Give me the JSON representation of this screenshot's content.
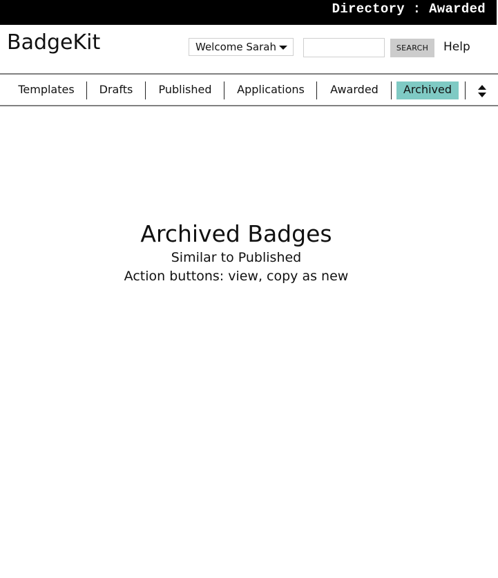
{
  "topbar": {
    "title": "Directory : Awarded"
  },
  "header": {
    "logo": "BadgeKit",
    "user_menu": {
      "selected": "Welcome Sarah",
      "icon": "caret-down-icon"
    },
    "search": {
      "value": "",
      "placeholder": "",
      "button_label": "SEARCH"
    },
    "help_label": "Help"
  },
  "nav": {
    "tabs": [
      {
        "label": "Templates",
        "active": false
      },
      {
        "label": "Drafts",
        "active": false
      },
      {
        "label": "Published",
        "active": false
      },
      {
        "label": "Applications",
        "active": false
      },
      {
        "label": "Awarded",
        "active": false
      },
      {
        "label": "Archived",
        "active": true
      }
    ],
    "sort_icon": "sort-up-down-icon",
    "active_color": "#7fcac4"
  },
  "main": {
    "title": "Archived Badges",
    "lines": [
      "Similar to Published",
      "Action buttons: view, copy as new"
    ]
  }
}
